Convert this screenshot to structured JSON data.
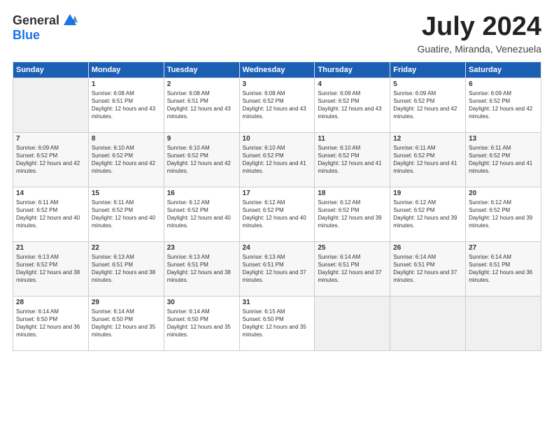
{
  "logo": {
    "general": "General",
    "blue": "Blue"
  },
  "title": "July 2024",
  "location": "Guatire, Miranda, Venezuela",
  "weekdays": [
    "Sunday",
    "Monday",
    "Tuesday",
    "Wednesday",
    "Thursday",
    "Friday",
    "Saturday"
  ],
  "weeks": [
    [
      {
        "day": "",
        "sunrise": "",
        "sunset": "",
        "daylight": ""
      },
      {
        "day": "1",
        "sunrise": "Sunrise: 6:08 AM",
        "sunset": "Sunset: 6:51 PM",
        "daylight": "Daylight: 12 hours and 43 minutes."
      },
      {
        "day": "2",
        "sunrise": "Sunrise: 6:08 AM",
        "sunset": "Sunset: 6:51 PM",
        "daylight": "Daylight: 12 hours and 43 minutes."
      },
      {
        "day": "3",
        "sunrise": "Sunrise: 6:08 AM",
        "sunset": "Sunset: 6:52 PM",
        "daylight": "Daylight: 12 hours and 43 minutes."
      },
      {
        "day": "4",
        "sunrise": "Sunrise: 6:09 AM",
        "sunset": "Sunset: 6:52 PM",
        "daylight": "Daylight: 12 hours and 43 minutes."
      },
      {
        "day": "5",
        "sunrise": "Sunrise: 6:09 AM",
        "sunset": "Sunset: 6:52 PM",
        "daylight": "Daylight: 12 hours and 42 minutes."
      },
      {
        "day": "6",
        "sunrise": "Sunrise: 6:09 AM",
        "sunset": "Sunset: 6:52 PM",
        "daylight": "Daylight: 12 hours and 42 minutes."
      }
    ],
    [
      {
        "day": "7",
        "sunrise": "Sunrise: 6:09 AM",
        "sunset": "Sunset: 6:52 PM",
        "daylight": "Daylight: 12 hours and 42 minutes."
      },
      {
        "day": "8",
        "sunrise": "Sunrise: 6:10 AM",
        "sunset": "Sunset: 6:52 PM",
        "daylight": "Daylight: 12 hours and 42 minutes."
      },
      {
        "day": "9",
        "sunrise": "Sunrise: 6:10 AM",
        "sunset": "Sunset: 6:52 PM",
        "daylight": "Daylight: 12 hours and 42 minutes."
      },
      {
        "day": "10",
        "sunrise": "Sunrise: 6:10 AM",
        "sunset": "Sunset: 6:52 PM",
        "daylight": "Daylight: 12 hours and 41 minutes."
      },
      {
        "day": "11",
        "sunrise": "Sunrise: 6:10 AM",
        "sunset": "Sunset: 6:52 PM",
        "daylight": "Daylight: 12 hours and 41 minutes."
      },
      {
        "day": "12",
        "sunrise": "Sunrise: 6:11 AM",
        "sunset": "Sunset: 6:52 PM",
        "daylight": "Daylight: 12 hours and 41 minutes."
      },
      {
        "day": "13",
        "sunrise": "Sunrise: 6:11 AM",
        "sunset": "Sunset: 6:52 PM",
        "daylight": "Daylight: 12 hours and 41 minutes."
      }
    ],
    [
      {
        "day": "14",
        "sunrise": "Sunrise: 6:11 AM",
        "sunset": "Sunset: 6:52 PM",
        "daylight": "Daylight: 12 hours and 40 minutes."
      },
      {
        "day": "15",
        "sunrise": "Sunrise: 6:11 AM",
        "sunset": "Sunset: 6:52 PM",
        "daylight": "Daylight: 12 hours and 40 minutes."
      },
      {
        "day": "16",
        "sunrise": "Sunrise: 6:12 AM",
        "sunset": "Sunset: 6:52 PM",
        "daylight": "Daylight: 12 hours and 40 minutes."
      },
      {
        "day": "17",
        "sunrise": "Sunrise: 6:12 AM",
        "sunset": "Sunset: 6:52 PM",
        "daylight": "Daylight: 12 hours and 40 minutes."
      },
      {
        "day": "18",
        "sunrise": "Sunrise: 6:12 AM",
        "sunset": "Sunset: 6:52 PM",
        "daylight": "Daylight: 12 hours and 39 minutes."
      },
      {
        "day": "19",
        "sunrise": "Sunrise: 6:12 AM",
        "sunset": "Sunset: 6:52 PM",
        "daylight": "Daylight: 12 hours and 39 minutes."
      },
      {
        "day": "20",
        "sunrise": "Sunrise: 6:12 AM",
        "sunset": "Sunset: 6:52 PM",
        "daylight": "Daylight: 12 hours and 39 minutes."
      }
    ],
    [
      {
        "day": "21",
        "sunrise": "Sunrise: 6:13 AM",
        "sunset": "Sunset: 6:52 PM",
        "daylight": "Daylight: 12 hours and 38 minutes."
      },
      {
        "day": "22",
        "sunrise": "Sunrise: 6:13 AM",
        "sunset": "Sunset: 6:51 PM",
        "daylight": "Daylight: 12 hours and 38 minutes."
      },
      {
        "day": "23",
        "sunrise": "Sunrise: 6:13 AM",
        "sunset": "Sunset: 6:51 PM",
        "daylight": "Daylight: 12 hours and 38 minutes."
      },
      {
        "day": "24",
        "sunrise": "Sunrise: 6:13 AM",
        "sunset": "Sunset: 6:51 PM",
        "daylight": "Daylight: 12 hours and 37 minutes."
      },
      {
        "day": "25",
        "sunrise": "Sunrise: 6:14 AM",
        "sunset": "Sunset: 6:51 PM",
        "daylight": "Daylight: 12 hours and 37 minutes."
      },
      {
        "day": "26",
        "sunrise": "Sunrise: 6:14 AM",
        "sunset": "Sunset: 6:51 PM",
        "daylight": "Daylight: 12 hours and 37 minutes."
      },
      {
        "day": "27",
        "sunrise": "Sunrise: 6:14 AM",
        "sunset": "Sunset: 6:51 PM",
        "daylight": "Daylight: 12 hours and 36 minutes."
      }
    ],
    [
      {
        "day": "28",
        "sunrise": "Sunrise: 6:14 AM",
        "sunset": "Sunset: 6:50 PM",
        "daylight": "Daylight: 12 hours and 36 minutes."
      },
      {
        "day": "29",
        "sunrise": "Sunrise: 6:14 AM",
        "sunset": "Sunset: 6:50 PM",
        "daylight": "Daylight: 12 hours and 35 minutes."
      },
      {
        "day": "30",
        "sunrise": "Sunrise: 6:14 AM",
        "sunset": "Sunset: 6:50 PM",
        "daylight": "Daylight: 12 hours and 35 minutes."
      },
      {
        "day": "31",
        "sunrise": "Sunrise: 6:15 AM",
        "sunset": "Sunset: 6:50 PM",
        "daylight": "Daylight: 12 hours and 35 minutes."
      },
      {
        "day": "",
        "sunrise": "",
        "sunset": "",
        "daylight": ""
      },
      {
        "day": "",
        "sunrise": "",
        "sunset": "",
        "daylight": ""
      },
      {
        "day": "",
        "sunrise": "",
        "sunset": "",
        "daylight": ""
      }
    ]
  ]
}
